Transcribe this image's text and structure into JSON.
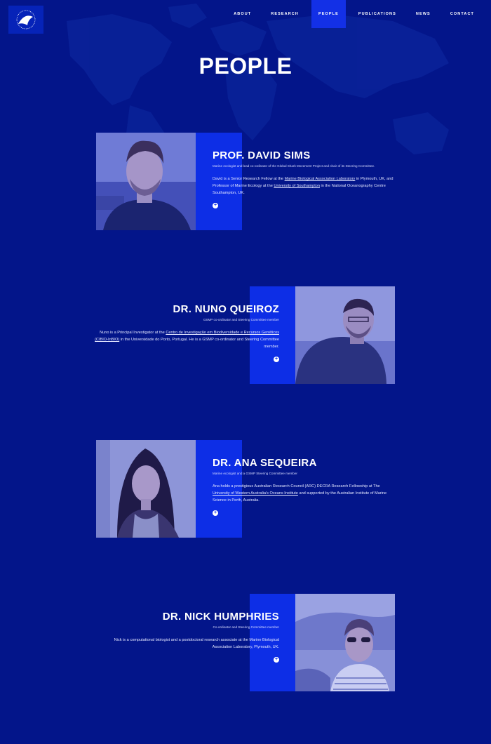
{
  "nav": {
    "items": [
      "ABOUT",
      "RESEARCH",
      "PEOPLE",
      "PUBLICATIONS",
      "NEWS",
      "CONTACT"
    ],
    "active_index": 2
  },
  "page": {
    "title": "PEOPLE"
  },
  "people": [
    {
      "name": "PROF. DAVID SIMS",
      "role": "Marine ecologist and lead co-ordinator of the Global Shark Movement Project and chair of its Steering Committee.",
      "bio_parts": [
        "David is a Senior Research Fellow at the ",
        "Marine Biological Association Laboratory",
        " in Plymouth, UK, and Professor of Marine Ecology at the ",
        "University of Southampton",
        " in the National Oceanography Centre Southampton, UK."
      ],
      "more": "+"
    },
    {
      "name": "DR. NUNO QUEIROZ",
      "role": "GSMP co-ordinator and Steering Committee member",
      "bio_parts": [
        "Nuno is a Principal Investigator at the ",
        "Centro de Investigação em Biodiversidade e Recursos Genéticos (CIBIO-InBIO)",
        " in the Universidade do Porto, Portugal. He is a GSMP co-ordinator and Steering Committee member."
      ],
      "more": "+"
    },
    {
      "name": "DR. ANA SEQUEIRA",
      "role": "Marine ecologist and a GSMP Steering Committee member",
      "bio_parts": [
        "Ana holds a prestigious Australian Research Council (ARC) DECRA Research Fellowship at The ",
        "University of Western Australia's Oceans Institute",
        " and supported by the Australian Institute of Marine Science in Perth, Australia."
      ],
      "more": "+"
    },
    {
      "name": "DR. NICK HUMPHRIES",
      "role": "Co-ordinator and Steering Committee member",
      "bio_parts": [
        "Nick is a computational biologist and a postdoctoral research associate at the Marine Biological Association Laboratory, Plymouth, UK."
      ],
      "more": "+"
    }
  ],
  "colors": {
    "background": "#03158a",
    "accent": "#0d2ee6",
    "nav_active": "#1330e6"
  },
  "icons": {
    "logo": "shark-fin-logo",
    "more": "plus-circle-icon"
  }
}
